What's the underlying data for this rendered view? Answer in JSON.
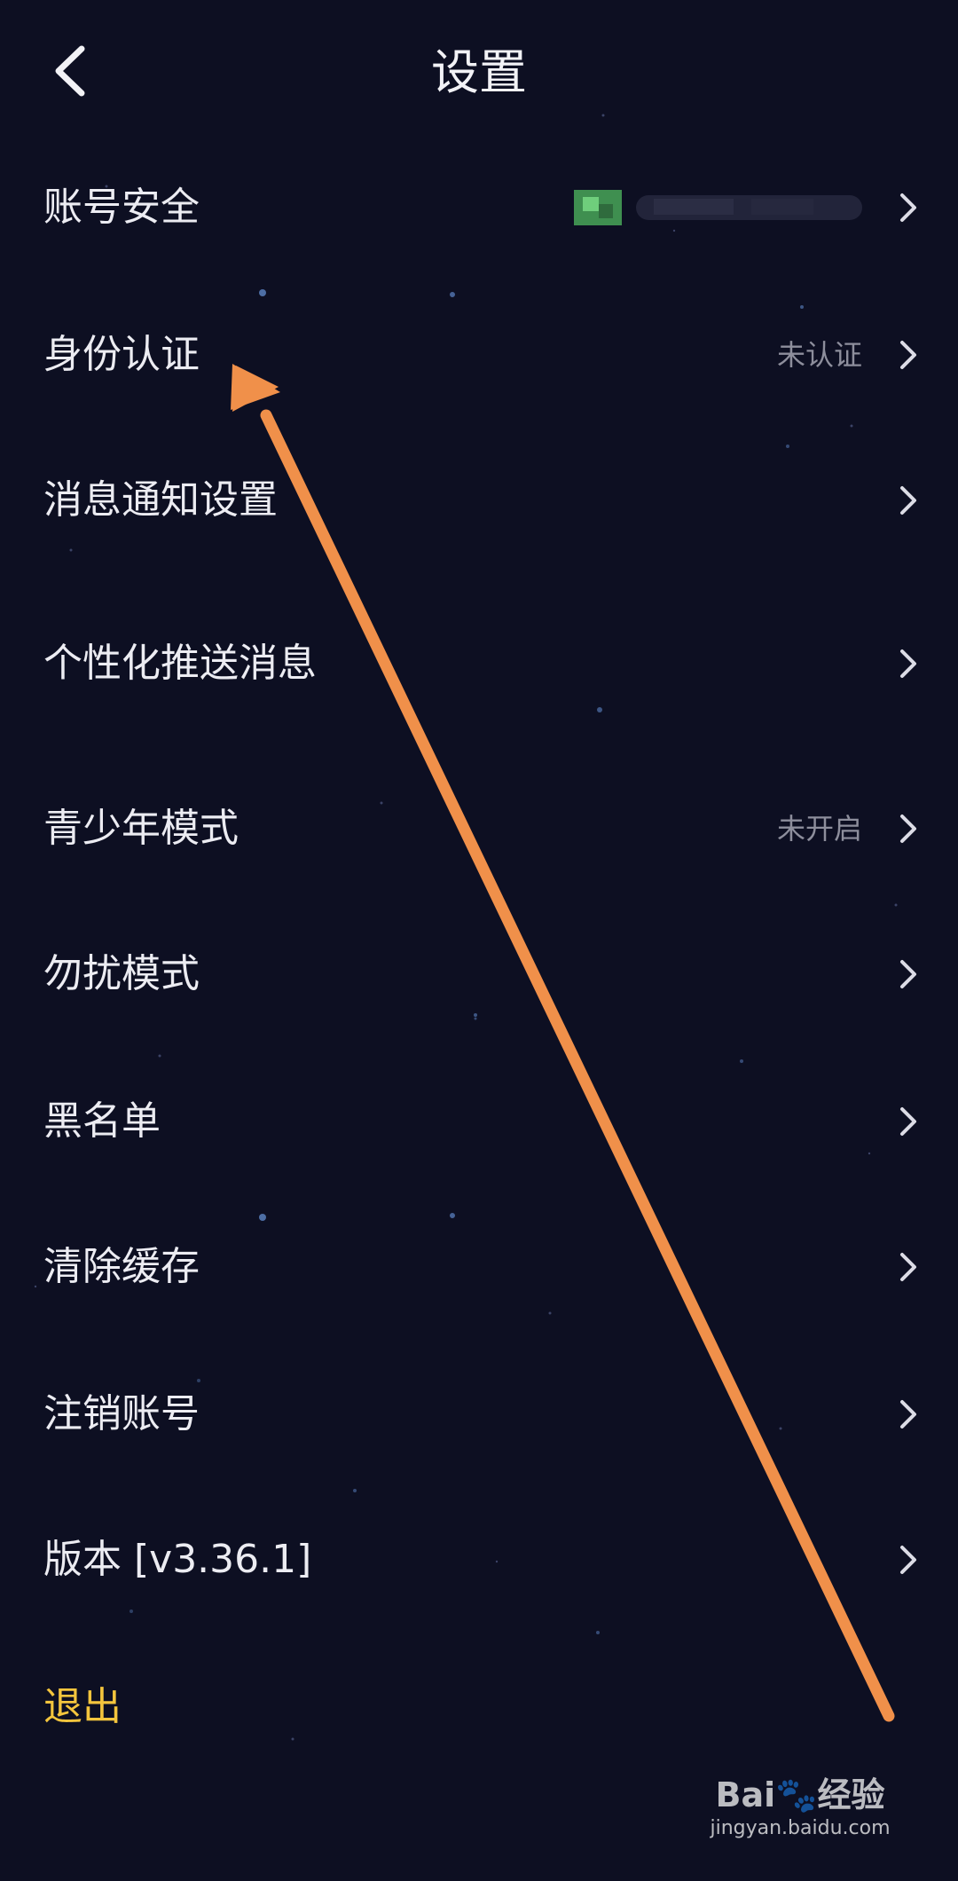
{
  "header": {
    "title": "设置",
    "back_icon": "chevron-left-icon"
  },
  "settings": [
    {
      "label": "账号安全",
      "value": "",
      "masked": true
    },
    {
      "label": "身份认证",
      "value": "未认证"
    },
    {
      "label": "消息通知设置",
      "value": ""
    },
    {
      "label": "个性化推送消息",
      "value": ""
    },
    {
      "label": "青少年模式",
      "value": "未开启"
    },
    {
      "label": "勿扰模式",
      "value": ""
    },
    {
      "label": "黑名单",
      "value": ""
    },
    {
      "label": "清除缓存",
      "value": ""
    },
    {
      "label": "注销账号",
      "value": ""
    },
    {
      "label": "版本 [v3.36.1]",
      "value": ""
    }
  ],
  "logout": {
    "label": "退出",
    "color": "#f4c53d"
  },
  "annotation": {
    "arrow_color": "#f0904a"
  },
  "watermark": {
    "logo_text": "Bai",
    "logo_suffix": "经验",
    "url": "jingyan.baidu.com"
  },
  "theme": {
    "background": "#0d0f22",
    "text": "#ececf2",
    "secondary_text": "#8d8e9c"
  }
}
